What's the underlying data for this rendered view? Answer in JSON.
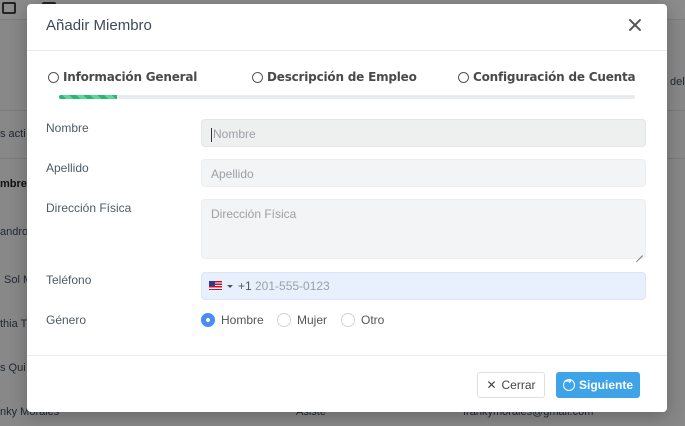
{
  "background": {
    "fragments": [
      "s acti",
      "mbre",
      "andro",
      "Sol M",
      "thia T",
      "s Qui",
      "nky Morales",
      "Asiste",
      "frankymorales@gmail.com",
      "del"
    ]
  },
  "modal": {
    "title": "Añadir Miembro",
    "steps": [
      {
        "label": "Información General"
      },
      {
        "label": "Descripción de Empleo"
      },
      {
        "label": "Configuración de Cuenta"
      }
    ],
    "progress_percent": 10,
    "fields": {
      "nombre": {
        "label": "Nombre",
        "placeholder": "Nombre"
      },
      "apellido": {
        "label": "Apellido",
        "placeholder": "Apellido"
      },
      "direccion": {
        "label": "Dirección Física",
        "placeholder": "Dirección Física"
      },
      "telefono": {
        "label": "Teléfono",
        "country": "US",
        "dial_code": "+1",
        "placeholder": "201-555-0123"
      },
      "genero": {
        "label": "Género",
        "options": [
          "Hombre",
          "Mujer",
          "Otro"
        ],
        "selected": "Hombre"
      }
    },
    "footer": {
      "close_label": "Cerrar",
      "next_label": "Siguiente"
    }
  },
  "colors": {
    "primary_button": "#3fa3e8",
    "radio_checked": "#4a8cf0",
    "progress": "#2bb673"
  }
}
